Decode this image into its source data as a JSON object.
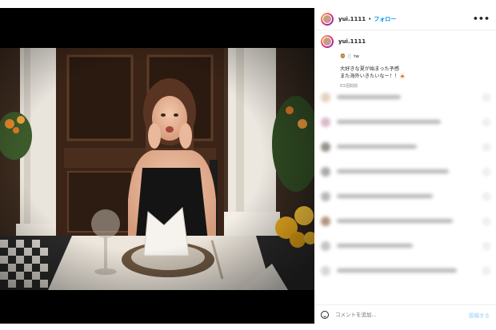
{
  "post": {
    "username": "yui.1111",
    "separator": "•",
    "follow_label": "フォロー",
    "more_label": "•••",
    "caption_username": "yui.1111",
    "caption_emoji": "🦁 🍴 tw",
    "caption_line1": "大好きな夏が始まった予感",
    "caption_line2": "また海外いきたいなー！！🍝",
    "time_ago": "63週間前",
    "comment_placeholder": "コメントを追加...",
    "post_button": "投稿する"
  },
  "colors": {
    "accent": "#0095f6",
    "post_disabled": "#b2dffc"
  }
}
